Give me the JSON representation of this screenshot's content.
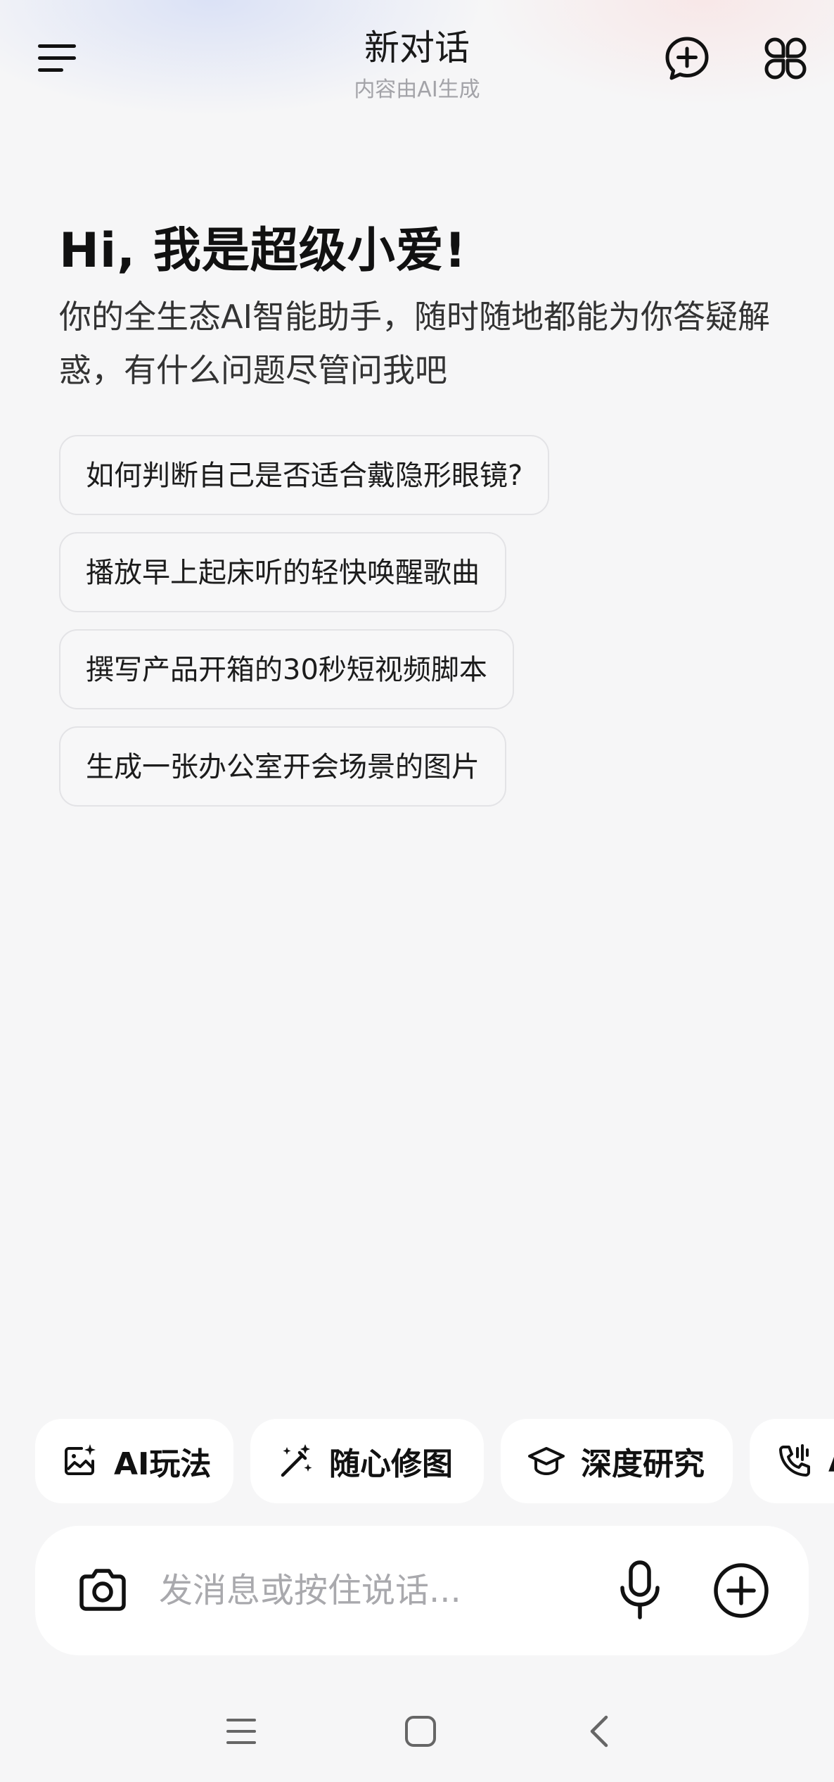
{
  "header": {
    "title": "新对话",
    "subtitle": "内容由AI生成"
  },
  "greeting": {
    "title": "Hi, 我是超级小爱!",
    "intro": "你的全生态AI智能助手，随时随地都能为你答疑解惑，有什么问题尽管问我吧"
  },
  "suggestions": [
    "如何判断自己是否适合戴隐形眼镜?",
    "播放早上起床听的轻快唤醒歌曲",
    "撰写产品开箱的30秒短视频脚本",
    "生成一张办公室开会场景的图片"
  ],
  "features": [
    {
      "label": "AI玩法",
      "icon": "image-sparkle-icon"
    },
    {
      "label": "随心修图",
      "icon": "magic-wand-icon"
    },
    {
      "label": "深度研究",
      "icon": "graduation-cap-icon"
    },
    {
      "label": "A",
      "icon": "phone-call-icon"
    }
  ],
  "input": {
    "placeholder": "发消息或按住说话..."
  },
  "icons": {
    "menu": "menu-icon",
    "new_chat": "chat-plus-icon",
    "apps": "apps-grid-icon",
    "camera": "camera-icon",
    "mic": "microphone-icon",
    "add": "plus-circle-icon"
  },
  "colors": {
    "background": "#f6f6f7",
    "chip_border": "#e3e3e6",
    "placeholder": "#a9a9ad"
  }
}
